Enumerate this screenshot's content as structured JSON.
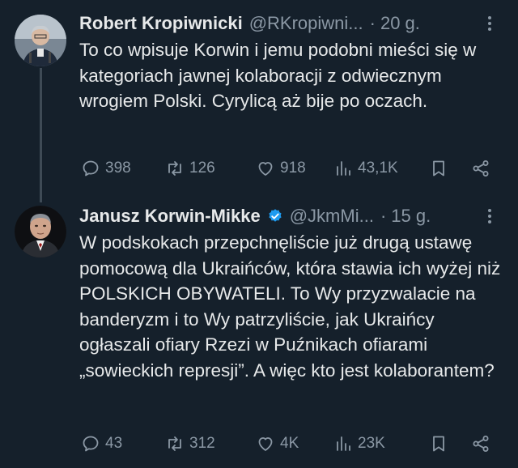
{
  "tweets": [
    {
      "name": "Robert Kropiwnicki",
      "handle": "@RKropiwni...",
      "dot": "·",
      "time": "20 g.",
      "text": "To co wpisuje Korwin i jemu podobni mieści się w kategoriach jawnej kolaboracji z odwiecznym wrogiem Polski. Cyrylicą aż bije po oczach.",
      "replies": "398",
      "retweets": "126",
      "likes": "918",
      "views": "43,1K"
    },
    {
      "name": "Janusz Korwin-Mikke",
      "handle": "@JkmMi...",
      "dot": "·",
      "time": "15 g.",
      "verified": true,
      "text": "W podskokach przepchnęliście już drugą ustawę pomocową dla Ukraińców, która stawia ich wyżej niż POLSKICH OBYWATELI. To Wy przyzwalacie na banderyzm i to Wy patrzyliście, jak Ukraińcy ogłaszali ofiary Rzezi w Puźnikach ofiarami „sowieckich represji”. A więc kto jest kolaborantem?",
      "replies": "43",
      "retweets": "312",
      "likes": "4K",
      "views": "23K"
    }
  ],
  "colors": {
    "background": "#15202b",
    "text": "#e7e9ea",
    "secondary": "#8b98a5",
    "verified": "#1d9bf0"
  },
  "icons": [
    "comment-icon",
    "retweet-icon",
    "heart-icon",
    "views-icon",
    "bookmark-icon",
    "share-icon",
    "more-icon",
    "verified-badge-icon"
  ]
}
